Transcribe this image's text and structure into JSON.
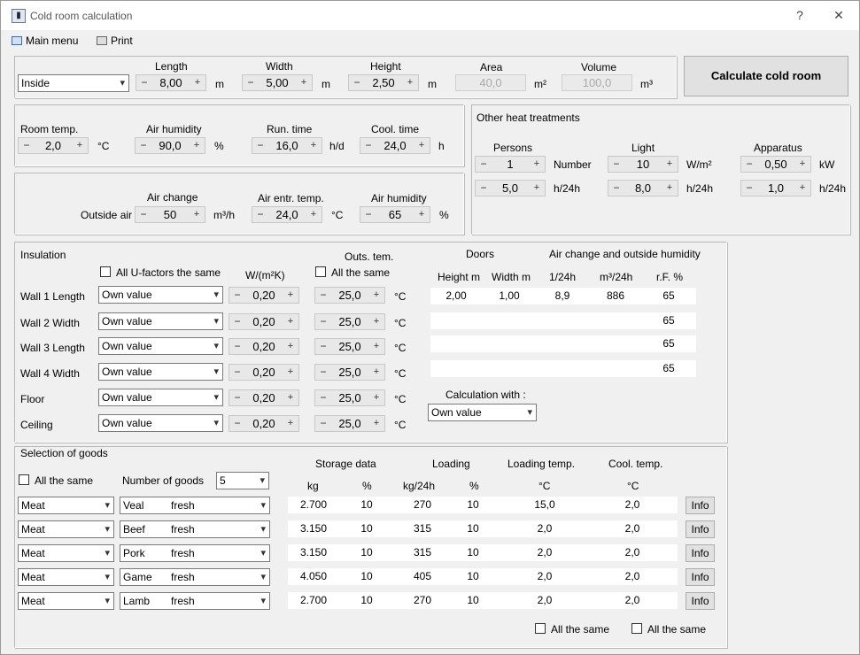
{
  "window": {
    "title": "Cold room calculation",
    "help": "?",
    "close": "✕"
  },
  "menu": {
    "main_menu": "Main menu",
    "print": "Print"
  },
  "dims": {
    "location": "Inside",
    "length_label": "Length",
    "length": "8,00",
    "length_unit": "m",
    "width_label": "Width",
    "width": "5,00",
    "width_unit": "m",
    "height_label": "Height",
    "height": "2,50",
    "height_unit": "m",
    "area_label": "Area",
    "area": "40,0",
    "area_unit": "m²",
    "volume_label": "Volume",
    "volume": "100,0",
    "volume_unit": "m³"
  },
  "calculate_button": "Calculate cold room",
  "room": {
    "room_temp_label": "Room temp.",
    "room_temp": "2,0",
    "room_temp_unit": "°C",
    "air_humidity_label": "Air humidity",
    "air_humidity": "90,0",
    "air_humidity_unit": "%",
    "run_time_label": "Run. time",
    "run_time": "16,0",
    "run_time_unit": "h/d",
    "cool_time_label": "Cool. time",
    "cool_time": "24,0",
    "cool_time_unit": "h"
  },
  "outside": {
    "row_label": "Outside air",
    "air_change_label": "Air change",
    "air_change": "50",
    "air_change_unit": "m³/h",
    "entr_temp_label": "Air entr. temp.",
    "entr_temp": "24,0",
    "entr_temp_unit": "°C",
    "humidity_label": "Air humidity",
    "humidity": "65",
    "humidity_unit": "%"
  },
  "heat": {
    "title": "Other heat treatments",
    "persons_label": "Persons",
    "persons": "1",
    "persons_unit": "Number",
    "persons_h": "5,0",
    "persons_h_unit": "h/24h",
    "light_label": "Light",
    "light": "10",
    "light_unit": "W/m²",
    "light_h": "8,0",
    "light_h_unit": "h/24h",
    "apparatus_label": "Apparatus",
    "apparatus": "0,50",
    "apparatus_unit": "kW",
    "apparatus_h": "1,0",
    "apparatus_h_unit": "h/24h"
  },
  "insulation": {
    "title": "Insulation",
    "all_u_label": "All U-factors the same",
    "u_header": "W/(m²K)",
    "outs_header": "Outs. tem.",
    "all_same_label": "All the same",
    "doors_header": "Doors",
    "air_change_header": "Air change and outside humidity",
    "col_height": "Height m",
    "col_width": "Width m",
    "col_per24": "1/24h",
    "col_m3": "m³/24h",
    "col_rf": "r.F. %",
    "temp_unit": "°C",
    "walls": [
      {
        "label": "Wall 1 Length",
        "type": "Own value",
        "u": "0,20",
        "temp": "25,0",
        "d_height": "2,00",
        "d_width": "1,00",
        "per24": "8,9",
        "m3": "886",
        "rf": "65"
      },
      {
        "label": "Wall 2 Width",
        "type": "Own value",
        "u": "0,20",
        "temp": "25,0",
        "rf": "65"
      },
      {
        "label": "Wall 3 Length",
        "type": "Own value",
        "u": "0,20",
        "temp": "25,0",
        "rf": "65"
      },
      {
        "label": "Wall 4 Width",
        "type": "Own value",
        "u": "0,20",
        "temp": "25,0",
        "rf": "65"
      },
      {
        "label": "Floor",
        "type": "Own value",
        "u": "0,20",
        "temp": "25,0"
      },
      {
        "label": "Ceiling",
        "type": "Own value",
        "u": "0,20",
        "temp": "25,0"
      }
    ],
    "calc_with_label": "Calculation with :",
    "calc_with": "Own value"
  },
  "goods": {
    "title": "Selection of goods",
    "all_same_label": "All the same",
    "number_label": "Number of goods",
    "number": "5",
    "storage_header": "Storage data",
    "loading_header": "Loading",
    "loading_temp_header": "Loading temp.",
    "cool_temp_header": "Cool. temp.",
    "col_kg": "kg",
    "col_pct": "%",
    "col_kg24": "kg/24h",
    "col_pct2": "%",
    "col_c1": "°C",
    "col_c2": "°C",
    "info": "Info",
    "rows": [
      {
        "cat": "Meat",
        "item": "Veal",
        "state": "fresh",
        "kg": "2.700",
        "pct": "10",
        "kg24": "270",
        "pct2": "10",
        "load_temp": "15,0",
        "cool_temp": "2,0"
      },
      {
        "cat": "Meat",
        "item": "Beef",
        "state": "fresh",
        "kg": "3.150",
        "pct": "10",
        "kg24": "315",
        "pct2": "10",
        "load_temp": "2,0",
        "cool_temp": "2,0"
      },
      {
        "cat": "Meat",
        "item": "Pork",
        "state": "fresh",
        "kg": "3.150",
        "pct": "10",
        "kg24": "315",
        "pct2": "10",
        "load_temp": "2,0",
        "cool_temp": "2,0"
      },
      {
        "cat": "Meat",
        "item": "Game",
        "state": "fresh",
        "kg": "4.050",
        "pct": "10",
        "kg24": "405",
        "pct2": "10",
        "load_temp": "2,0",
        "cool_temp": "2,0"
      },
      {
        "cat": "Meat",
        "item": "Lamb",
        "state": "fresh",
        "kg": "2.700",
        "pct": "10",
        "kg24": "270",
        "pct2": "10",
        "load_temp": "2,0",
        "cool_temp": "2,0"
      }
    ],
    "all_same_load": "All the same",
    "all_same_cool": "All the same"
  }
}
